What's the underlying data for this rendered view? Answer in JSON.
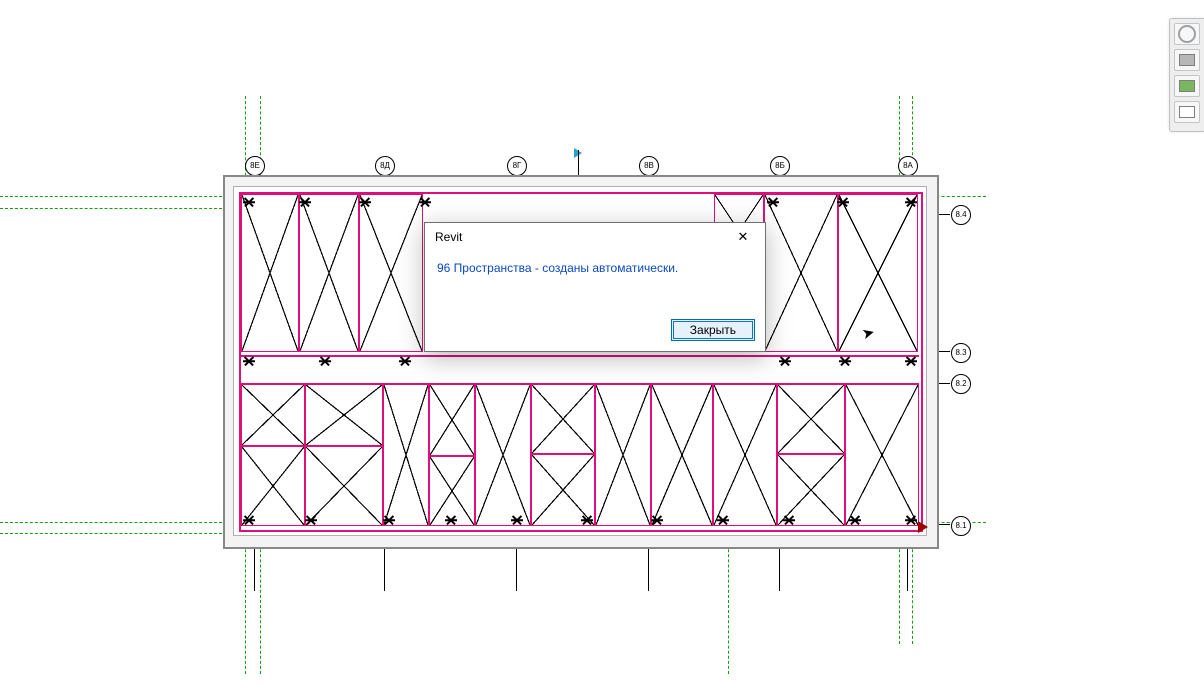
{
  "dialog": {
    "title": "Revit",
    "message": "96 Пространства - созданы автоматически.",
    "close_label": "Закрыть",
    "close_x": "✕"
  },
  "grids": {
    "top": [
      "8Е",
      "8Д",
      "8Г",
      "8В",
      "8Б",
      "8А"
    ],
    "right": [
      "8.4",
      "8.3",
      "8.2",
      "8.1"
    ]
  },
  "palette": {
    "items": [
      "ring",
      "grey",
      "green",
      "white"
    ]
  }
}
